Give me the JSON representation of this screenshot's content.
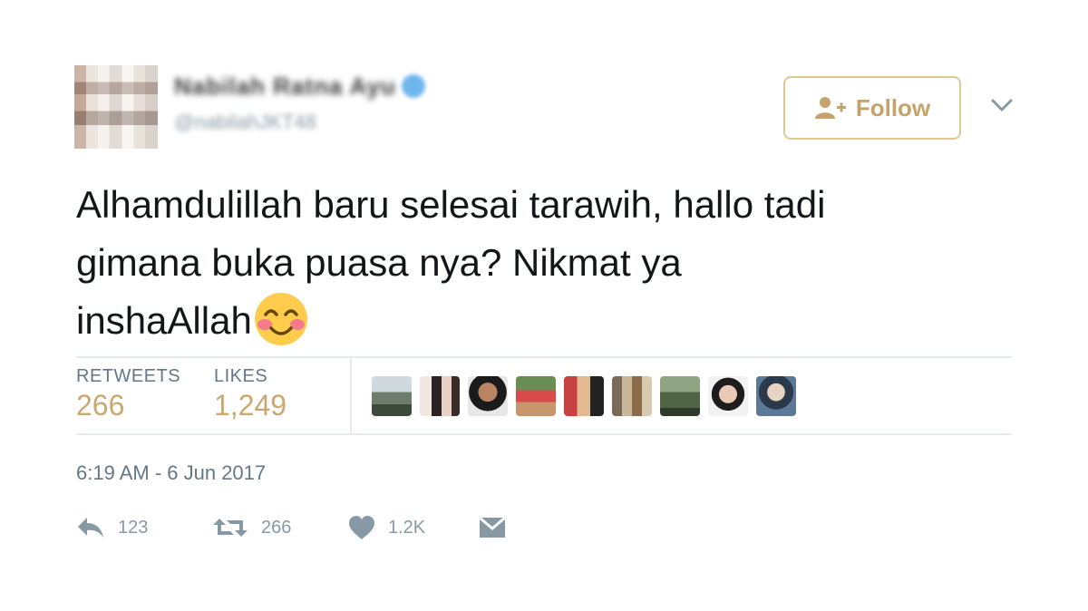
{
  "author": {
    "display_name": "Nabilah Ratna Ayu",
    "handle": "@nabilahJKT48"
  },
  "header": {
    "follow_label": "Follow"
  },
  "tweet": {
    "line1": "Alhamdulillah baru selesai tarawih, hallo tadi",
    "line2": "gimana buka puasa nya? Nikmat ya",
    "line3": "inshaAllah"
  },
  "stats": {
    "retweets_label": "RETWEETS",
    "retweets_value": "266",
    "likes_label": "LIKES",
    "likes_value": "1,249"
  },
  "timestamp": "6:19 AM - 6 Jun 2017",
  "actions": {
    "reply_count": "123",
    "retweet_count": "266",
    "like_count": "1.2K"
  },
  "colors": {
    "accent": "#c9a871",
    "follow_border": "#e0c896",
    "muted": "#657786",
    "icon": "#8899a6"
  },
  "icons": [
    "follow-person-icon",
    "chevron-down-icon",
    "smiling-blush-emoji",
    "reply-icon",
    "retweet-icon",
    "heart-icon",
    "envelope-icon"
  ]
}
